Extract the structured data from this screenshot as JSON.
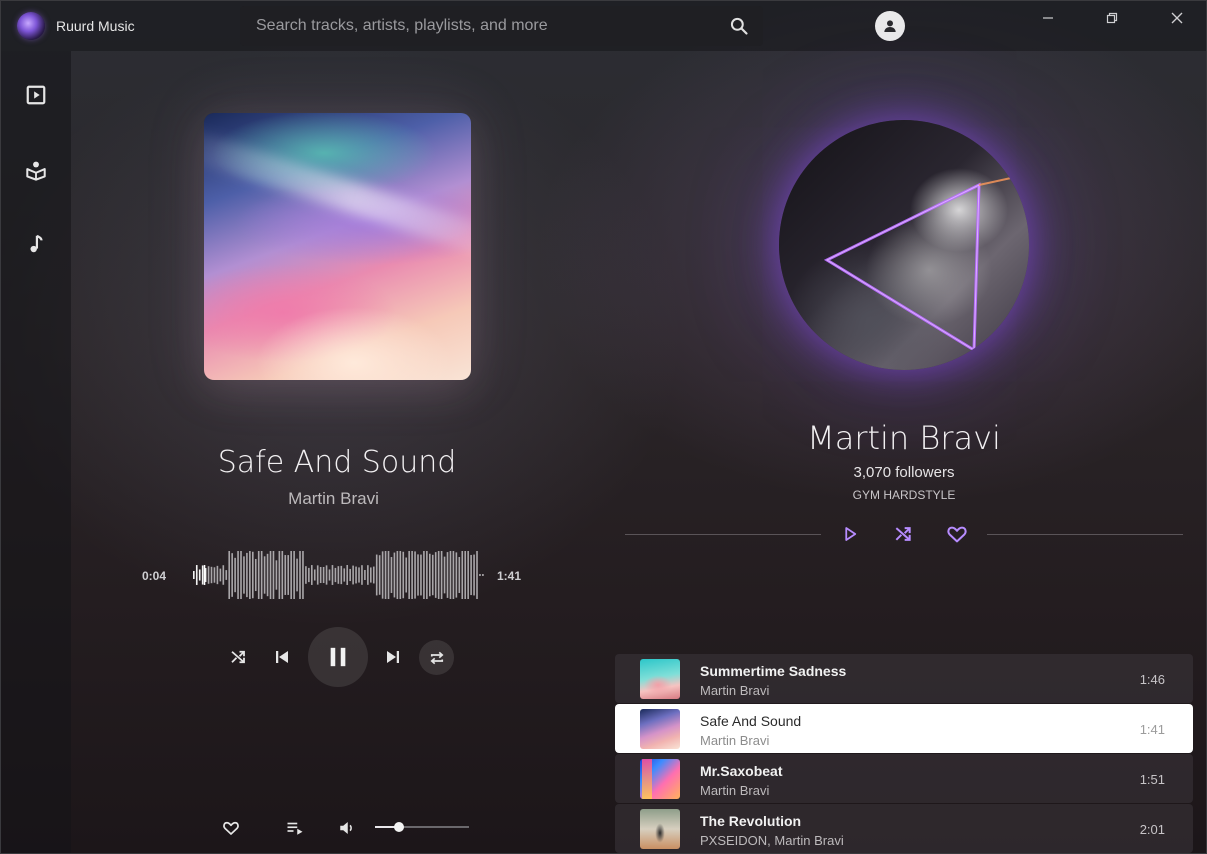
{
  "app": {
    "title": "Ruurd Music"
  },
  "search": {
    "placeholder": "Search tracks, artists, playlists, and more"
  },
  "window_controls": [
    "minimize-icon",
    "restore-icon",
    "close-icon"
  ],
  "sidebar": {
    "items": [
      {
        "icon": "play-square-icon"
      },
      {
        "icon": "library-icon"
      },
      {
        "icon": "music-note-icon"
      }
    ]
  },
  "now_playing": {
    "title": "Safe And Sound",
    "artist": "Martin Bravi",
    "elapsed": "0:04",
    "duration": "1:41",
    "progress_fraction": 0.04,
    "volume_fraction": 0.25,
    "state": "playing"
  },
  "artist": {
    "name": "Martin Bravi",
    "followers": "3,070 followers",
    "genre": "GYM HARDSTYLE"
  },
  "colors": {
    "accent": "#b78cff",
    "active_row": "#ffffff"
  },
  "tracks": [
    {
      "title": "Summertime Sadness",
      "artist": "Martin Bravi",
      "duration": "1:46",
      "active": false
    },
    {
      "title": "Safe And Sound",
      "artist": "Martin Bravi",
      "duration": "1:41",
      "active": true
    },
    {
      "title": "Mr.Saxobeat",
      "artist": "Martin Bravi",
      "duration": "1:51",
      "active": false
    },
    {
      "title": "The Revolution",
      "artist": "PXSEIDON,   Martin Bravi",
      "duration": "2:01",
      "active": false
    }
  ]
}
